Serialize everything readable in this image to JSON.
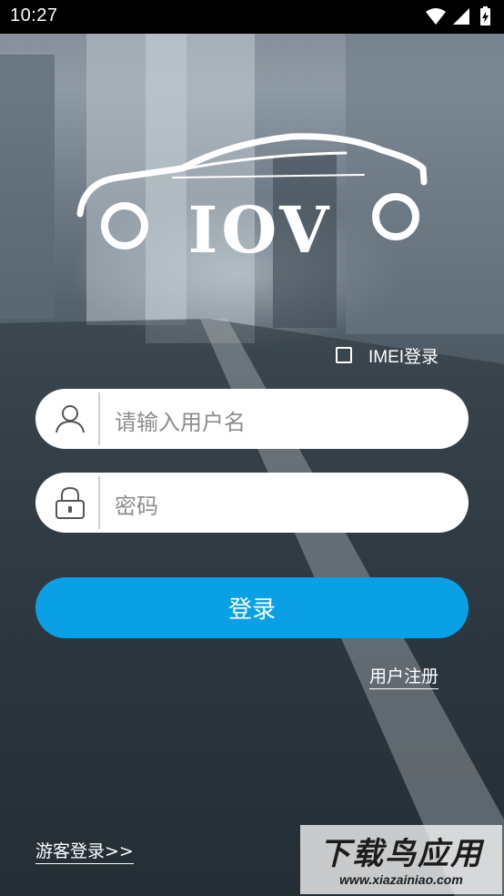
{
  "status_bar": {
    "time": "10:27",
    "icons": [
      "wifi-icon",
      "signal-icon",
      "battery-icon"
    ]
  },
  "logo": {
    "wordmark": "IOV"
  },
  "imei_option": {
    "label": "IMEI登录",
    "checked": false
  },
  "username_field": {
    "placeholder": "请输入用户名",
    "icon": "user-icon"
  },
  "password_field": {
    "placeholder": "密码",
    "icon": "lock-icon"
  },
  "login_button": {
    "label": "登录"
  },
  "register_link": {
    "label": "用户注册"
  },
  "guest_link": {
    "label": "游客登录>>"
  },
  "watermark": {
    "title": "下载鸟应用",
    "url": "www.xiazainiao.com"
  },
  "colors": {
    "accent": "#0aa0e6",
    "field_bg": "#ffffff",
    "placeholder": "#8d8d8d",
    "status_bar_bg": "#000000"
  }
}
